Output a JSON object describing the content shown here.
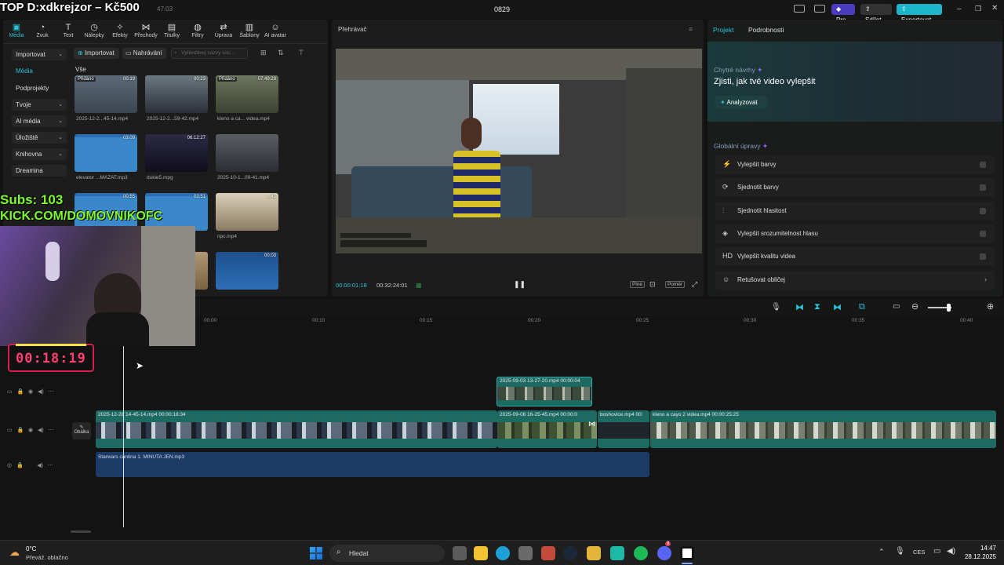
{
  "overlay": {
    "stream_title": "TOP D:xdkrejzor – Kč500",
    "subs": "Subs: 103",
    "kick": "KICK.COM/DOMOVNIKOFC",
    "timer": "00:18:19"
  },
  "titlebar": {
    "time_fragment": "47:03",
    "project_name": "0829",
    "pro_label": "Pro",
    "share_label": "Sdílet",
    "export_label": "Exportovat"
  },
  "toolbar": {
    "items": [
      {
        "label": "Média",
        "icon": "media-icon"
      },
      {
        "label": "Zvuk",
        "icon": "audio-icon"
      },
      {
        "label": "Text",
        "icon": "text-icon"
      },
      {
        "label": "Nálepky",
        "icon": "sticker-icon"
      },
      {
        "label": "Efekty",
        "icon": "effects-icon"
      },
      {
        "label": "Přechody",
        "icon": "transitions-icon"
      },
      {
        "label": "Titulky",
        "icon": "captions-icon"
      },
      {
        "label": "Filtry",
        "icon": "filters-icon"
      },
      {
        "label": "Úprava",
        "icon": "adjust-icon"
      },
      {
        "label": "Šablony",
        "icon": "templates-icon"
      },
      {
        "label": "AI avatar",
        "icon": "ai-avatar-icon"
      }
    ]
  },
  "sidebar": {
    "items": [
      {
        "label": "Importovat",
        "chevron": true
      },
      {
        "label": "Média",
        "chevron": false
      },
      {
        "label": "Podprojekty",
        "chevron": false
      },
      {
        "label": "Tvoje",
        "chevron": true
      },
      {
        "label": "AI média",
        "chevron": true
      },
      {
        "label": "Úložiště",
        "chevron": true
      },
      {
        "label": "Knihovna",
        "chevron": true
      },
      {
        "label": "Dreamina",
        "chevron": false
      }
    ]
  },
  "media_toolbar": {
    "import_label": "Importovat",
    "record_label": "Nahrávání",
    "search_placeholder": "Vyhledávej názvy sou...",
    "filter_all": "Vše"
  },
  "media_items": [
    {
      "name": "2025-12-2...45-14.mp4",
      "duration": "00:19",
      "badge": "Přidáno"
    },
    {
      "name": "2025-12-2...59-42.mp4",
      "duration": "00:23",
      "badge": ""
    },
    {
      "name": "kleno a ca... videa.mp4",
      "duration": "07:49:29",
      "badge": "Přidáno"
    },
    {
      "name": "elevator ...MAZAT.mp3",
      "duration": "03:09",
      "badge": ""
    },
    {
      "name": "dukie5.mpg",
      "duration": "06:12:27",
      "badge": ""
    },
    {
      "name": "2025-10-1...09-41.mp4",
      "duration": "",
      "badge": ""
    },
    {
      "name": "",
      "duration": "00:55",
      "badge": ""
    },
    {
      "name": "...mp3",
      "duration": "03:51",
      "badge": ""
    },
    {
      "name": "npc.mp4",
      "duration": "...41",
      "badge": ""
    },
    {
      "name": "",
      "duration": "",
      "badge": ""
    },
    {
      "name": "",
      "duration": "",
      "badge": ""
    },
    {
      "name": "",
      "duration": "00:03",
      "badge": ""
    }
  ],
  "player": {
    "title": "Přehrávač",
    "current_time": "00:00:01:18",
    "total_time": "00:32:24:01",
    "full_label": "Plné",
    "ratio_label": "Poměr"
  },
  "right_panel": {
    "tabs": [
      "Projekt",
      "Podrobnosti"
    ],
    "smart_title": "Chytré návrhy",
    "smart_subtitle": "Zjisti, jak tvé video vylepšit",
    "analyze_label": "Analyzovat",
    "global_title": "Globální úpravy",
    "enhancements": [
      {
        "label": "Vylepšit barvy",
        "icon": "magic-wand-icon",
        "glyph": "⚡"
      },
      {
        "label": "Sjednotit barvy",
        "icon": "color-match-icon",
        "glyph": "⟳"
      },
      {
        "label": "Sjednotit hlasitost",
        "icon": "volume-sliders-icon",
        "glyph": "⫶"
      },
      {
        "label": "Vylepšit srozumitelnost hlasu",
        "icon": "voice-icon",
        "glyph": "◈"
      },
      {
        "label": "Vylepšit kvalitu videa",
        "icon": "hd-icon",
        "glyph": "HD"
      },
      {
        "label": "Retušovat obličej",
        "icon": "face-icon",
        "glyph": "☺"
      }
    ]
  },
  "timeline": {
    "ruler": [
      "00:00",
      "00:10",
      "00:15",
      "00:20",
      "00:25",
      "00:30",
      "00:35",
      "00:40"
    ],
    "cover_label": "Obálka",
    "clips": {
      "overlay_clip": "2025-09-03 13-27-20.mp4   00:00:04",
      "main1": "2025-12-28 14-45-14.mp4   00:00:18:34",
      "main2": "2025-09-06 16-25-45.mp4   00:00:0",
      "main3": "boshovice.mp4   00:",
      "main4": "kleno a cayo 2 videa.mp4   00:00:25:25",
      "audio": "Starwars cantina 1. MINUTA JEN.mp3"
    }
  },
  "taskbar": {
    "temperature": "0°C",
    "weather": "Převáž. oblačno",
    "search_label": "Hledat",
    "lang": "CES",
    "time": "14:47",
    "date": "28.12.2025",
    "discord_badge": "9"
  },
  "colors": {
    "accent": "#27c2d6",
    "clip_teal": "#1d6a63",
    "audio_blue": "#1c3a66",
    "pro_purple": "#4b3bbf"
  }
}
